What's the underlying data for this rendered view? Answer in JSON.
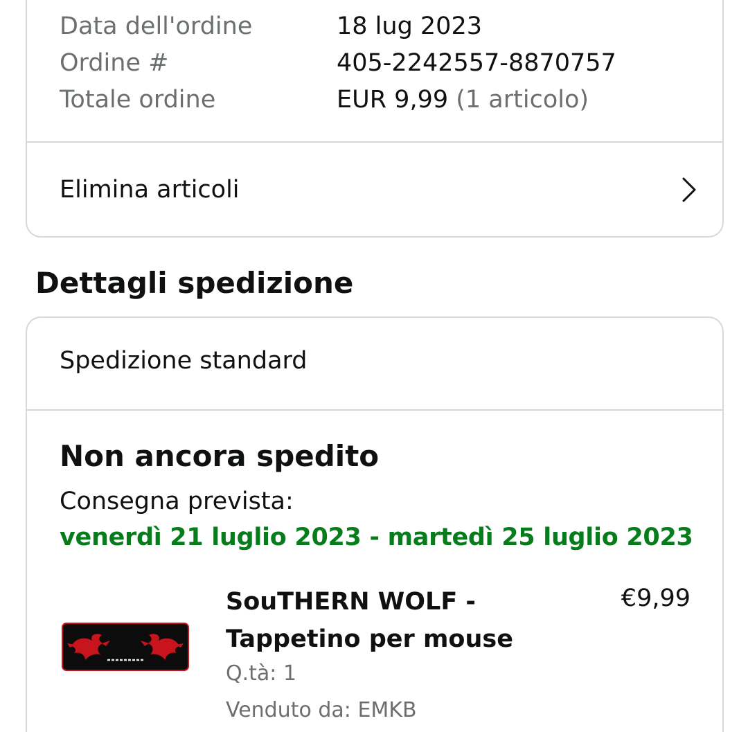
{
  "order_summary": {
    "rows": [
      {
        "label": "Data dell'ordine",
        "value": "18 lug 2023"
      },
      {
        "label": "Ordine #",
        "value": "405-2242557-8870757"
      },
      {
        "label": "Totale ordine",
        "value": "EUR 9,99",
        "value_extra": "(1 articolo)"
      }
    ],
    "remove_items_label": "Elimina articoli"
  },
  "shipping_section": {
    "title": "Dettagli spedizione",
    "shipping_type": "Spedizione standard",
    "status": "Non ancora spedito",
    "delivery_label": "Consegna prevista:",
    "delivery_range": "venerdì 21 luglio 2023 - martedì 25 luglio 2023"
  },
  "product": {
    "title": "SouTHERN WOLF - Tappetino per mouse",
    "price": "€9,99",
    "quantity": "Q.tà: 1",
    "seller": "Venduto da: EMKB",
    "thumbnail_logo_text": "SOUTHERN WOLF"
  },
  "colors": {
    "delivery_green": "#067d1a",
    "border_gray": "#d5d9d9",
    "muted_text": "#6b6f70",
    "mousepad_red": "#c8141c"
  },
  "icons": {
    "chevron": "chevron-right-icon"
  }
}
